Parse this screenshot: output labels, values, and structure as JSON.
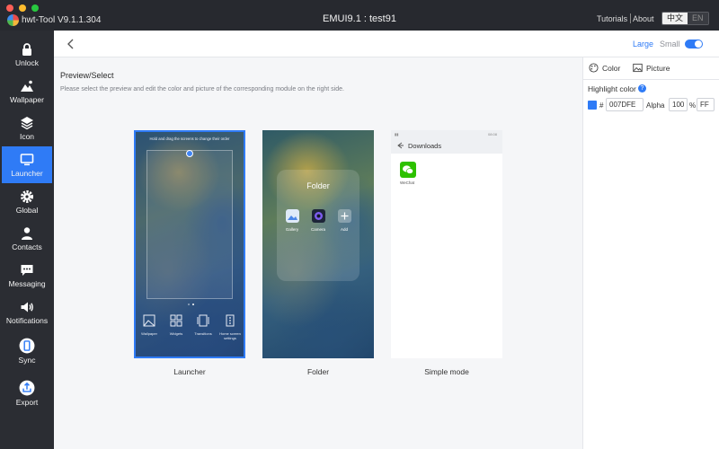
{
  "window": {
    "app_title": "hwt-Tool V9.1.1.304",
    "center_title": "EMUI9.1 :  test91",
    "links": {
      "tutorials": "Tutorials",
      "about": "About"
    },
    "languages": [
      "中文",
      "EN"
    ],
    "traffic_colors": [
      "#fe5f57",
      "#febc2e",
      "#28c840"
    ]
  },
  "sidebar": {
    "items": [
      {
        "label": "Unlock",
        "icon": "lock-icon"
      },
      {
        "label": "Wallpaper",
        "icon": "wallpaper-icon"
      },
      {
        "label": "Icon",
        "icon": "layers-icon"
      },
      {
        "label": "Launcher",
        "icon": "monitor-icon",
        "active": true
      },
      {
        "label": "Global",
        "icon": "gear-icon"
      },
      {
        "label": "Contacts",
        "icon": "person-icon"
      },
      {
        "label": "Messaging",
        "icon": "chat-icon"
      },
      {
        "label": "Notifications",
        "icon": "speaker-icon"
      },
      {
        "label": "Sync",
        "icon": "phone-icon"
      },
      {
        "label": "Export",
        "icon": "export-icon"
      }
    ]
  },
  "header": {
    "size_large": "Large",
    "size_small": "Small"
  },
  "main": {
    "title": "Preview/Select",
    "description": "Please select the preview and edit the color and picture of the corresponding module on the right side.",
    "previews": [
      {
        "label": "Launcher",
        "hint": "Hold and drag the screens to change their order",
        "dock": [
          "Wallpaper",
          "Widgets",
          "Transitions",
          "Home screen settings"
        ]
      },
      {
        "label": "Folder",
        "folder_title": "Folder",
        "apps": [
          "Gallery",
          "Camera",
          "Add"
        ]
      },
      {
        "label": "Simple mode",
        "status_time": "08:08",
        "header": "Downloads",
        "app": "WeChat"
      }
    ]
  },
  "panel": {
    "tabs": {
      "color": "Color",
      "picture": "Picture"
    },
    "highlight_label": "Highlight color",
    "hash": "#",
    "hex_value": "007DFE",
    "alpha_label": "Alpha",
    "alpha_value": "100",
    "percent": "%",
    "alpha_hex": "FF",
    "accent": "#2f7bf6",
    "swatch_color": "#2f7bf6"
  }
}
